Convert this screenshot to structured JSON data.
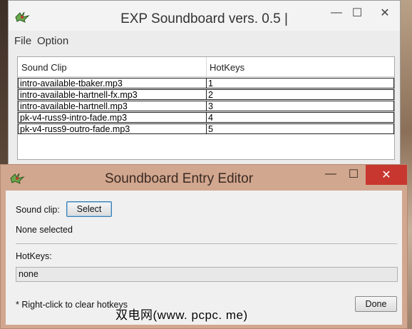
{
  "main_window": {
    "title": "EXP Soundboard vers. 0.5 |",
    "controls": {
      "minimize": "—",
      "maximize": "☐",
      "close": "✕"
    },
    "menu": [
      "File",
      "Option"
    ],
    "table": {
      "columns": [
        "Sound Clip",
        "HotKeys"
      ],
      "rows": [
        {
          "clip": "intro-available-tbaker.mp3",
          "hotkey": "1"
        },
        {
          "clip": "intro-available-hartnell-fx.mp3",
          "hotkey": "2"
        },
        {
          "clip": "intro-available-hartnell.mp3",
          "hotkey": "3"
        },
        {
          "clip": "pk-v4-russ9-intro-fade.mp3",
          "hotkey": "4"
        },
        {
          "clip": "pk-v4-russ9-outro-fade.mp3",
          "hotkey": "5"
        }
      ]
    }
  },
  "dialog": {
    "title": "Soundboard Entry Editor",
    "controls": {
      "minimize": "—",
      "maximize": "☐",
      "close": "✕"
    },
    "sound_clip_label": "Sound clip:",
    "select_button": "Select",
    "selection_status": "None selected",
    "hotkeys_label": "HotKeys:",
    "hotkeys_value": "none",
    "hint": "* Right-click to clear hotkeys",
    "done_button": "Done"
  },
  "watermark": "双电网(www. pcpc. me)",
  "colors": {
    "dialog_titlebar": "#d2a78f",
    "close_button": "#c7372f",
    "window_bg": "#f0f0f0"
  }
}
